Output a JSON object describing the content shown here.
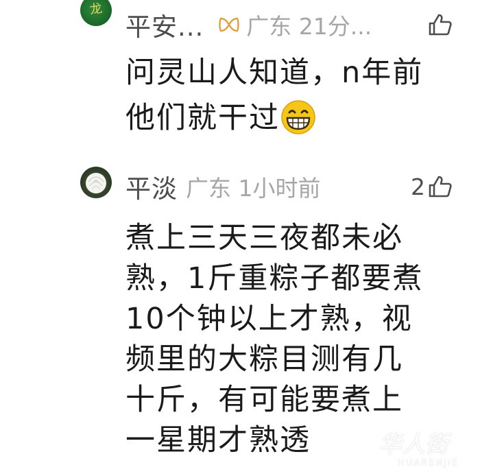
{
  "comments": [
    {
      "nickname": "平安...",
      "badge_icon": "bowtie-icon",
      "location_time": "广东 21分...",
      "like_count": "",
      "text_lines": [
        "问灵山人知道，n年前",
        "他们就干过"
      ],
      "emoji_icon": "grinning-face-icon",
      "avatar_glyph": "龙"
    },
    {
      "nickname": "平淡",
      "location_time": "广东 1小时前",
      "like_count": "2",
      "text_lines": [
        "煮上三天三夜都未必",
        "熟，1斤重粽子都要煮",
        "10个钟以上才熟，视",
        "频里的大粽目测有几",
        "十斤，有可能要煮上",
        "一星期才熟透"
      ]
    }
  ],
  "watermark": {
    "top": "华人街",
    "bottom": "HUARENJIE"
  },
  "colors": {
    "nickname": "#4d4d4d",
    "meta": "#a6a6a6",
    "text": "#1a1a1a",
    "badge": "#e0a040"
  }
}
